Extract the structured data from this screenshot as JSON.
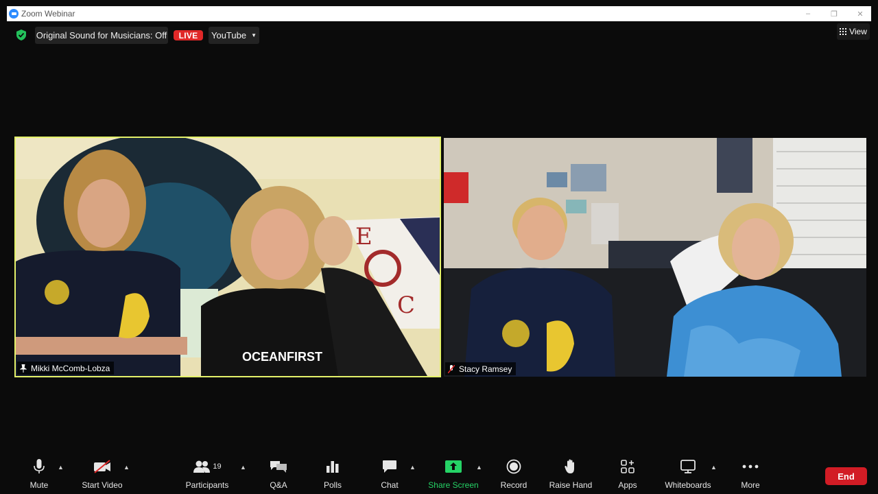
{
  "window": {
    "title": "Zoom Webinar",
    "controls": [
      "–",
      "❐",
      "✕"
    ]
  },
  "topbar": {
    "sound_label": "Original Sound for Musicians: Off",
    "live_label": "LIVE",
    "stream_target": "YouTube",
    "view_label": "View"
  },
  "participants": [
    {
      "name": "Mikki McComb-Lobza",
      "active_speaker": true
    },
    {
      "name": "Stacy Ramsey",
      "active_speaker": false
    }
  ],
  "toolbar": {
    "mute": "Mute",
    "start_video": "Start Video",
    "participants": "Participants",
    "participant_count": "19",
    "qa": "Q&A",
    "polls": "Polls",
    "chat": "Chat",
    "share_screen": "Share Screen",
    "record": "Record",
    "raise_hand": "Raise Hand",
    "apps": "Apps",
    "whiteboards": "Whiteboards",
    "more": "More",
    "end": "End"
  },
  "colors": {
    "active_speaker_border": "#e4f26a",
    "live_badge": "#e02828",
    "share_green": "#25d366",
    "end_red": "#d21c25",
    "zoom_blue": "#2d8cff"
  }
}
